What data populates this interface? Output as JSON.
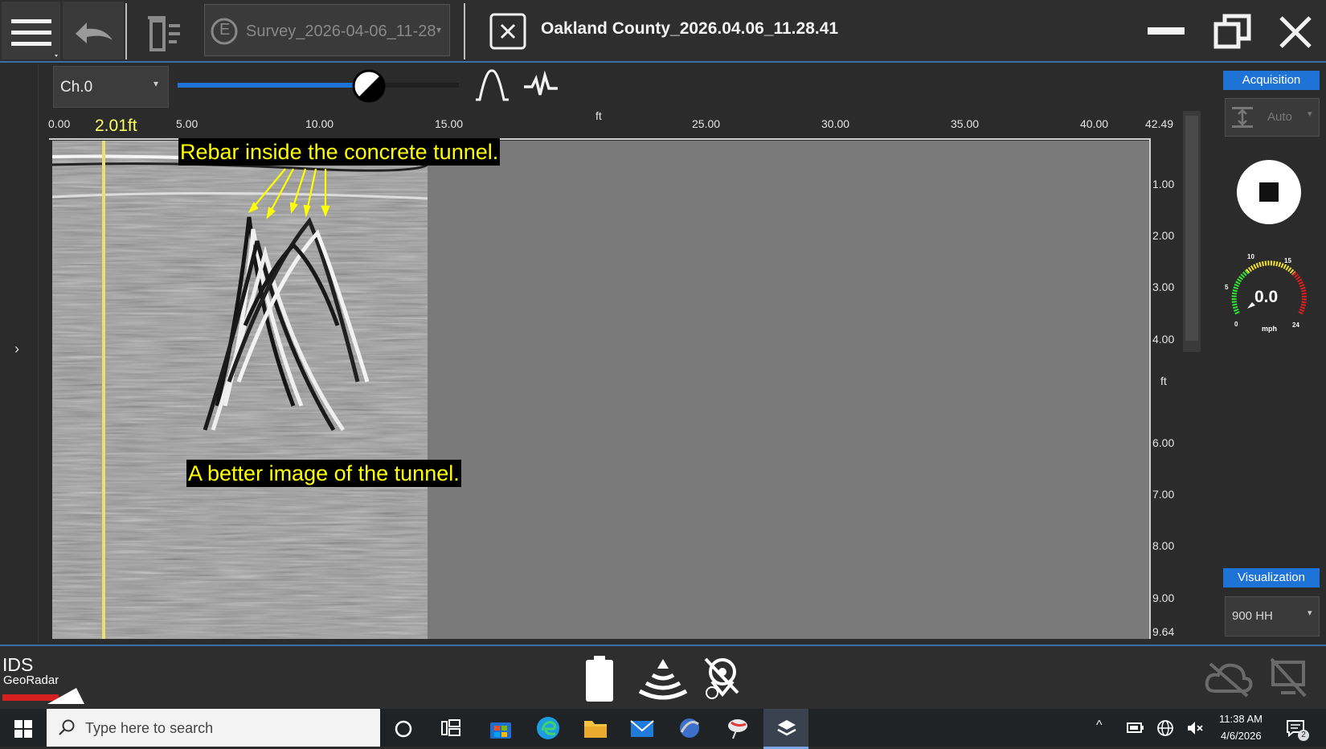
{
  "toolbar": {
    "survey_name": "Survey_2026-04-06_11-28",
    "survey_prefix": "E",
    "window_title": "Oakland County_2026.04.06_11.28.41"
  },
  "channel": {
    "selected": "Ch.0"
  },
  "gain_slider": {
    "value_fraction": 0.68
  },
  "ruler": {
    "unit": "ft",
    "cursor_label": "2.01ft",
    "x_ticks": [
      "0.00",
      "5.00",
      "10.00",
      "15.00",
      "25.00",
      "30.00",
      "35.00",
      "40.00",
      "42.49"
    ],
    "y_ticks": [
      "1.00",
      "2.00",
      "3.00",
      "4.00",
      "6.00",
      "7.00",
      "8.00",
      "9.00",
      "9.64"
    ],
    "y_unit": "ft"
  },
  "annotations": {
    "rebar": "Rebar inside the concrete tunnel.",
    "tunnel": "A better image of the tunnel."
  },
  "acquisition": {
    "label": "Acquisition",
    "mode": "Auto"
  },
  "speedometer": {
    "value": "0.0",
    "unit": "mph",
    "marks": [
      "0",
      "5",
      "10",
      "15",
      "24"
    ]
  },
  "visualization": {
    "label": "Visualization",
    "selected": "900 HH"
  },
  "brand": {
    "line1": "IDS",
    "line2": "GeoRadar"
  },
  "taskbar": {
    "search_placeholder": "Type here to search",
    "time": "11:38 AM",
    "date": "4/6/2026",
    "notifications": "2"
  },
  "colors": {
    "accent_blue": "#1e73d6",
    "annotation_yellow": "#ffff00",
    "slider_fill": "#1e73d6"
  }
}
